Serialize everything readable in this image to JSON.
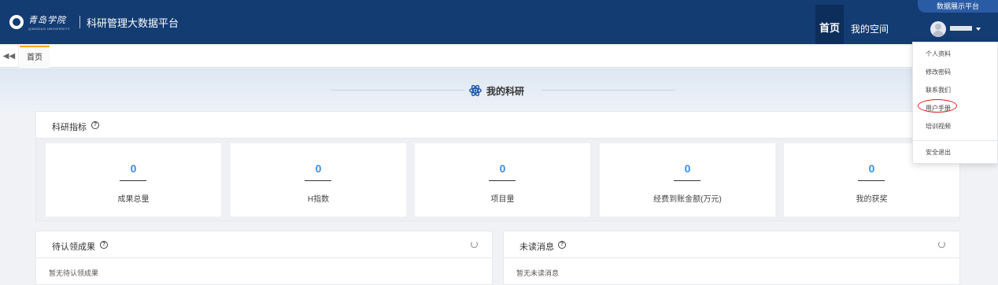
{
  "header": {
    "logo_text": "青岛学院",
    "logo_subtext": "QINGDAO UNIVERSITY",
    "app_title": "科研管理大数据平台",
    "top_badge": "数据展示平台",
    "nav": {
      "home": "首页",
      "my_space": "我的空间"
    },
    "accent_color": "#133c73"
  },
  "tabbar": {
    "tabs": [
      {
        "label": "首页"
      }
    ]
  },
  "section": {
    "title": "我的科研",
    "icon": "atom-icon"
  },
  "metrics": {
    "title": "科研指标",
    "help": "?",
    "cards": [
      {
        "value": "0",
        "label": "成果总量"
      },
      {
        "value": "0",
        "label": "H指数"
      },
      {
        "value": "0",
        "label": "项目量"
      },
      {
        "value": "0",
        "label": "经费到账金额(万元)"
      },
      {
        "value": "0",
        "label": "我的获奖"
      }
    ]
  },
  "pending": {
    "title": "待认领成果",
    "help": "?",
    "empty_text": "暂无待认领成果"
  },
  "unread": {
    "title": "未读消息",
    "help": "?",
    "empty_text": "暂无未读消息"
  },
  "user_menu": {
    "items": [
      "个人资料",
      "修改密码",
      "联系我们",
      "用户手册",
      "培训视频"
    ],
    "logout": "安全退出",
    "highlighted": "用户手册"
  }
}
